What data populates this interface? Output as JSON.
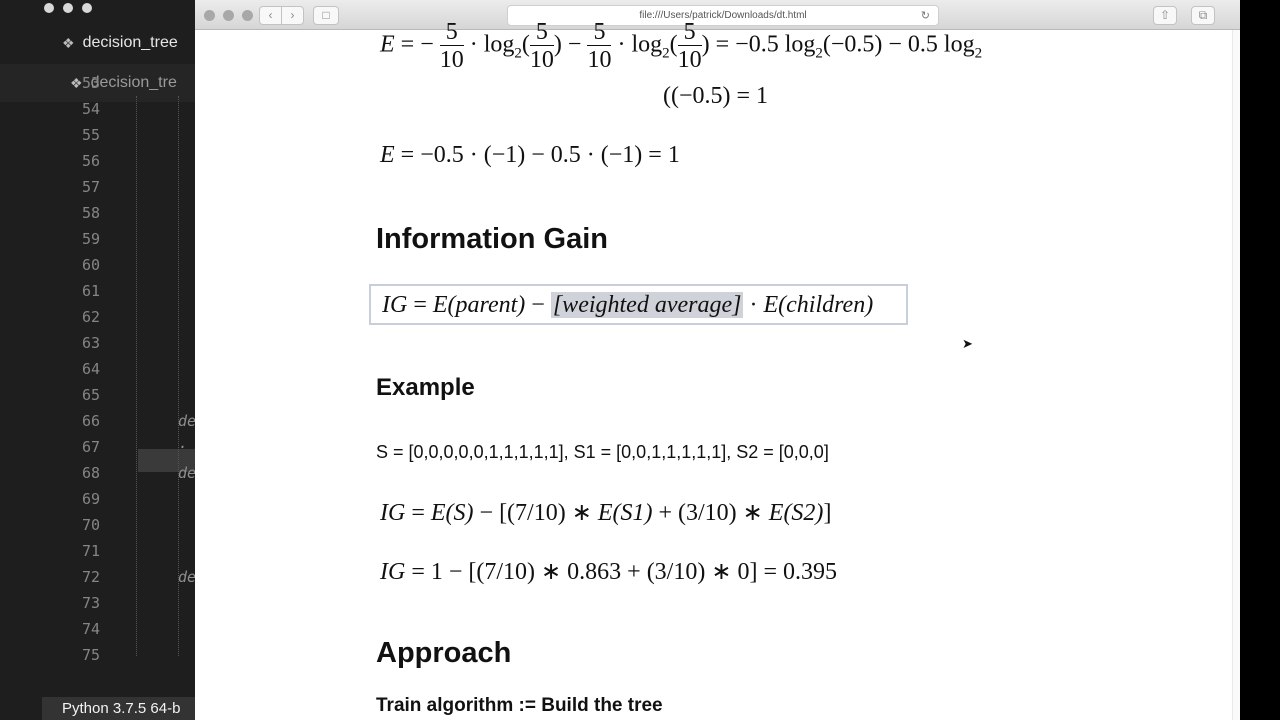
{
  "editor": {
    "tab_active": "decision_tree",
    "tab_second": "decision_tre",
    "line_numbers": [
      "53",
      "54",
      "55",
      "56",
      "57",
      "58",
      "59",
      "60",
      "61",
      "62",
      "63",
      "64",
      "65",
      "66",
      "67",
      "68",
      "69",
      "70",
      "71",
      "72",
      "73",
      "74",
      "75"
    ],
    "code_fragments": [
      {
        "line": "66",
        "text": "de"
      },
      {
        "line": "67",
        "text": "·"
      },
      {
        "line": "68",
        "text": "de"
      },
      {
        "line": "72",
        "text": "de"
      }
    ],
    "status_text": "Python 3.7.5 64-b"
  },
  "browser": {
    "url": "file:///Users/patrick/Downloads/dt.html",
    "back_icon": "‹",
    "forward_icon": "›",
    "sidebar_icon": "□",
    "reload_icon": "↻",
    "share_icon": "⇧",
    "tabs_icon": "⧉"
  },
  "content": {
    "entropy_line1": {
      "lhs": "E",
      "eq": " = −",
      "frac_num": "5",
      "frac_den": "10",
      "dot_log": " · log",
      "sub": "2",
      "open": "(",
      "close": ")",
      "minus": " − ",
      "rhs": ") = −0.5 log",
      "rhs_sub": "2",
      "rhs2": "(−0.5) − 0.5 log",
      "rhs2_sub": "2"
    },
    "entropy_line2": "((−0.5) = 1",
    "entropy_line3": {
      "lhs": "E",
      "rhs": " = −0.5 · (−1) − 0.5 · (−1) = 1"
    },
    "heading_info_gain": "Information Gain",
    "ig_formula": {
      "ig": "IG",
      "eq": " = ",
      "ep": "E(parent)",
      "minus": " − ",
      "weighted": "[weighted average]",
      "dot": " · ",
      "ec": "E(children)"
    },
    "heading_example": "Example",
    "example_sets": "S = [0,0,0,0,0,1,1,1,1,1], S1 = [0,0,1,1,1,1,1], S2 = [0,0,0]",
    "ig_example": {
      "ig": "IG",
      "eq": " = ",
      "es": "E(S)",
      "mid1": " − [(7/10) ∗ ",
      "es1": "E(S1)",
      "mid2": " + (3/10) ∗ ",
      "es2": "E(S2)",
      "end": "]"
    },
    "ig_result": {
      "ig": "IG",
      "rhs": " = 1 − [(7/10) ∗ 0.863 + (3/10) ∗ 0] = 0.395"
    },
    "heading_approach": "Approach",
    "train_algorithm": "Train algorithm := Build the tree"
  }
}
